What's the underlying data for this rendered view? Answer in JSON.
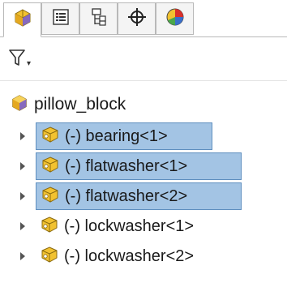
{
  "tabs": [
    {
      "name": "feature-manager",
      "icon": "assembly-icon",
      "active": true
    },
    {
      "name": "property-manager",
      "icon": "property-list-icon",
      "active": false
    },
    {
      "name": "configuration-manager",
      "icon": "configuration-icon",
      "active": false
    },
    {
      "name": "dimxpert-manager",
      "icon": "crosshair-icon",
      "active": false
    },
    {
      "name": "display-manager",
      "icon": "display-pie-icon",
      "active": false
    }
  ],
  "filter": {
    "icon": "filter-icon",
    "dropdown_glyph": "▾"
  },
  "tree": {
    "root": {
      "label": "pillow_block",
      "icon": "assembly-icon"
    },
    "items": [
      {
        "label": "(-) bearing<1>",
        "selected": true,
        "icon": "part-icon"
      },
      {
        "label": "(-) flatwasher<1>",
        "selected": true,
        "icon": "part-icon"
      },
      {
        "label": "(-) flatwasher<2>",
        "selected": true,
        "icon": "part-icon"
      },
      {
        "label": "(-) lockwasher<1>",
        "selected": false,
        "icon": "part-icon"
      },
      {
        "label": "(-) lockwasher<2>",
        "selected": false,
        "icon": "part-icon"
      }
    ]
  },
  "colors": {
    "selection_bg": "#a3c4e4",
    "selection_border": "#5f8fbf",
    "part_yellow": "#f2c230"
  }
}
